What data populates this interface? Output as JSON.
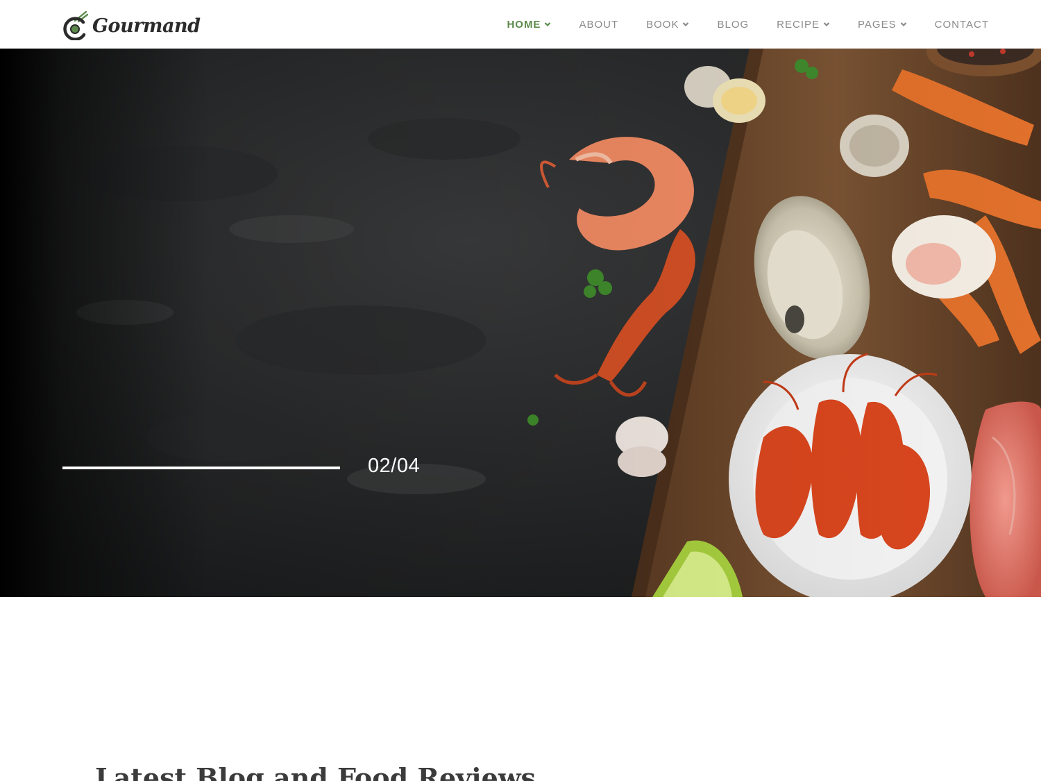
{
  "header": {
    "logo_text": "Gourmand",
    "nav": [
      {
        "label": "HOME",
        "dropdown": true,
        "active": true
      },
      {
        "label": "ABOUT",
        "dropdown": false,
        "active": false
      },
      {
        "label": "BOOK",
        "dropdown": true,
        "active": false
      },
      {
        "label": "BLOG",
        "dropdown": false,
        "active": false
      },
      {
        "label": "RECIPE",
        "dropdown": true,
        "active": false
      },
      {
        "label": "PAGES",
        "dropdown": true,
        "active": false
      },
      {
        "label": "CONTACT",
        "dropdown": false,
        "active": false
      }
    ]
  },
  "hero": {
    "slide_counter": "02/04",
    "progress": 1.0
  },
  "latest": {
    "title": "Latest Blog and Food Reviews"
  },
  "colors": {
    "accent": "#5b8a4a",
    "nav_text": "#8a8a8a",
    "hero_dark": "#1e1f20"
  },
  "icons": {
    "logo": "bowl-with-chopsticks-icon",
    "dropdown": "chevron-down-icon"
  }
}
